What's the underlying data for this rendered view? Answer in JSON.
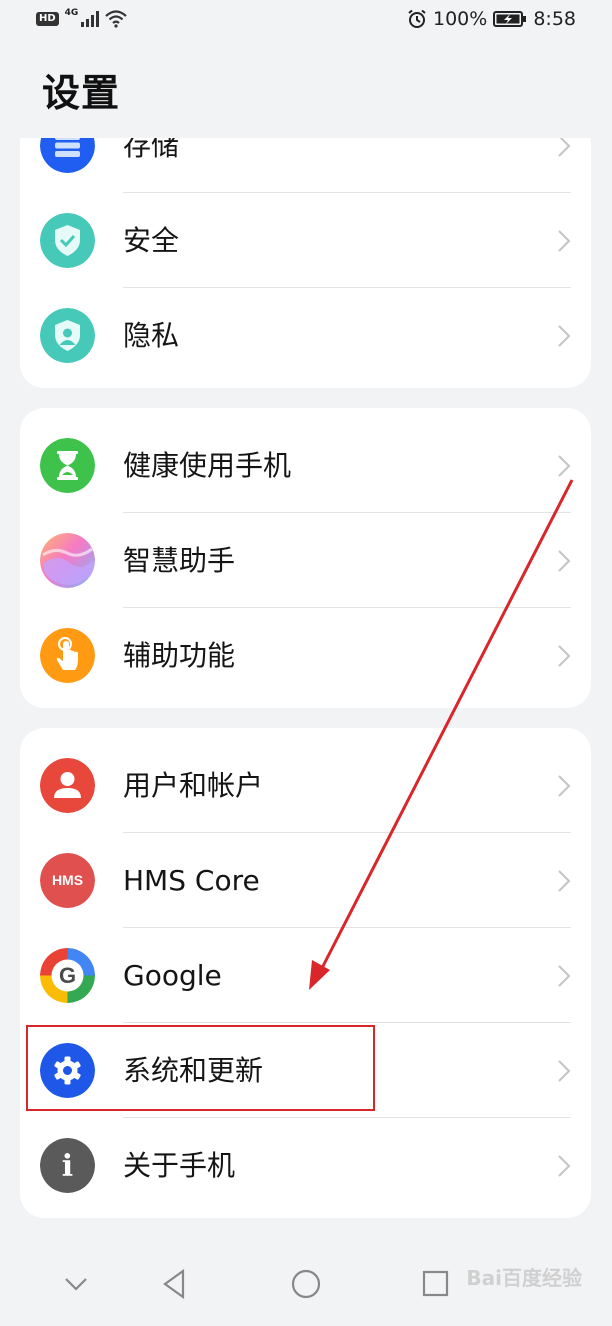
{
  "status_bar": {
    "hd": "HD",
    "network": "4G",
    "battery_percent": "100%",
    "time": "8:58"
  },
  "page": {
    "title": "设置"
  },
  "groups": [
    {
      "items": [
        {
          "label": "存储",
          "icon": "storage-icon"
        },
        {
          "label": "安全",
          "icon": "security-shield-icon"
        },
        {
          "label": "隐私",
          "icon": "privacy-icon"
        }
      ]
    },
    {
      "items": [
        {
          "label": "健康使用手机",
          "icon": "hourglass-icon"
        },
        {
          "label": "智慧助手",
          "icon": "assistant-icon"
        },
        {
          "label": "辅助功能",
          "icon": "accessibility-hand-icon"
        }
      ]
    },
    {
      "items": [
        {
          "label": "用户和帐户",
          "icon": "user-icon"
        },
        {
          "label": "HMS Core",
          "icon": "hms-core-icon",
          "icon_text": "HMS"
        },
        {
          "label": "Google",
          "icon": "google-icon",
          "icon_text": "G"
        },
        {
          "label": "系统和更新",
          "icon": "gear-icon"
        },
        {
          "label": "关于手机",
          "icon": "info-icon",
          "icon_text": "i"
        }
      ]
    }
  ],
  "colors": {
    "background": "#f1f3f5",
    "card": "#ffffff",
    "storage": "#1f5ef0",
    "security": "#46c9b8",
    "health": "#3fc24c",
    "accessibility": "#ff9a12",
    "user": "#e8473c",
    "hms": "#e0504f",
    "system": "#1f57e8",
    "about": "#5a5a5a",
    "annotation": "#d9262b"
  },
  "watermark": "Bai百度经验"
}
